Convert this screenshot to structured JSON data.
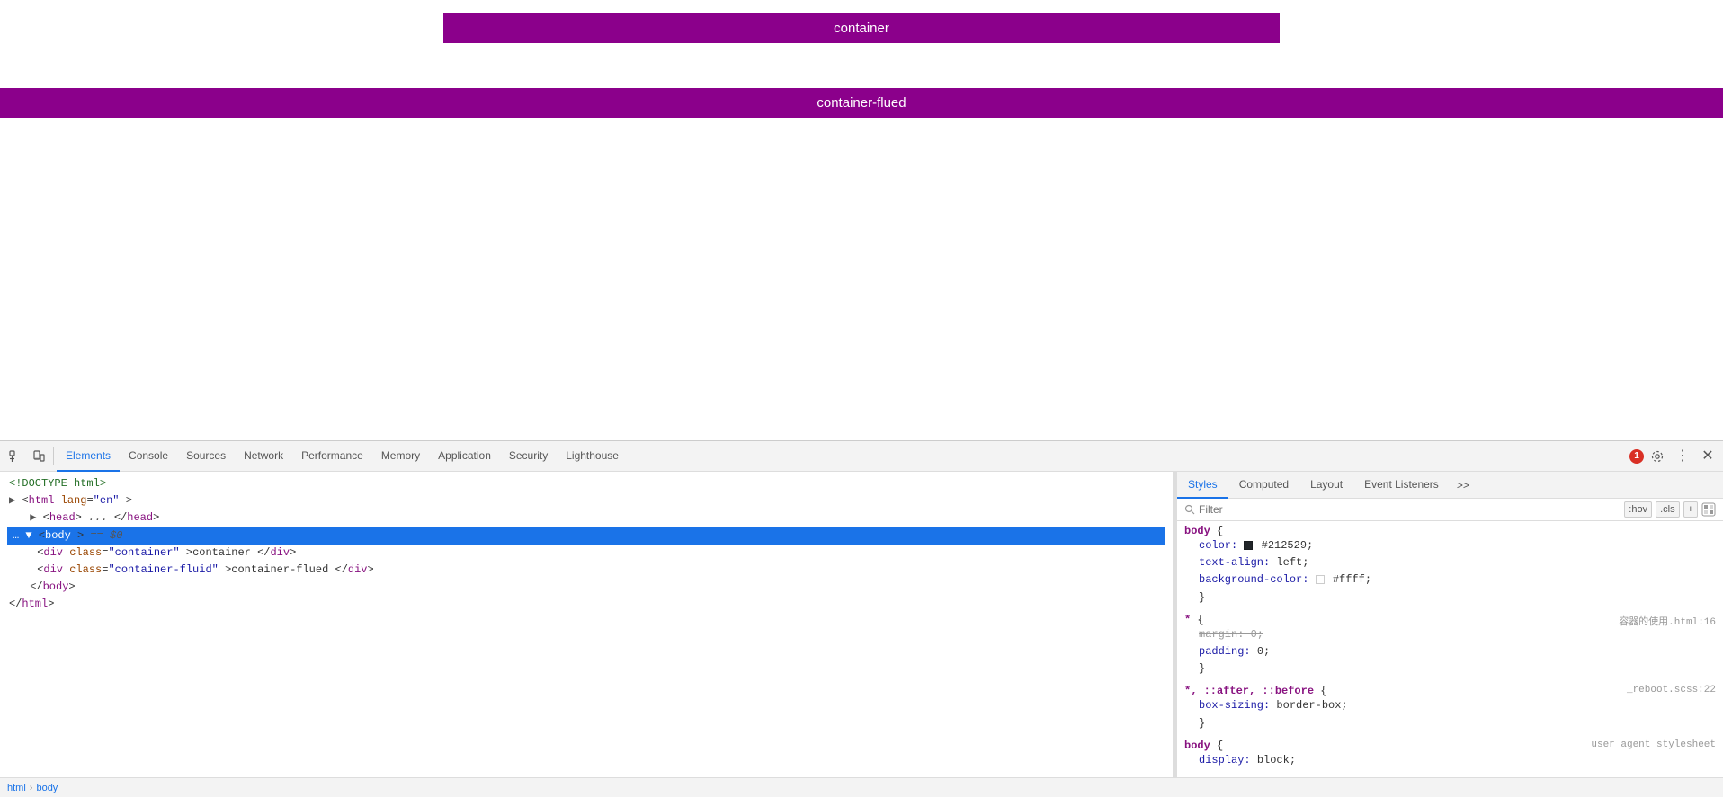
{
  "preview": {
    "container_label": "container",
    "container_fluid_label": "container-flued"
  },
  "devtools": {
    "tabs": [
      {
        "id": "elements",
        "label": "Elements",
        "active": true
      },
      {
        "id": "console",
        "label": "Console",
        "active": false
      },
      {
        "id": "sources",
        "label": "Sources",
        "active": false
      },
      {
        "id": "network",
        "label": "Network",
        "active": false
      },
      {
        "id": "performance",
        "label": "Performance",
        "active": false
      },
      {
        "id": "memory",
        "label": "Memory",
        "active": false
      },
      {
        "id": "application",
        "label": "Application",
        "active": false
      },
      {
        "id": "security",
        "label": "Security",
        "active": false
      },
      {
        "id": "lighthouse",
        "label": "Lighthouse",
        "active": false
      }
    ],
    "error_count": "1",
    "styles_tabs": [
      {
        "id": "styles",
        "label": "Styles",
        "active": true
      },
      {
        "id": "computed",
        "label": "Computed",
        "active": false
      },
      {
        "id": "layout",
        "label": "Layout",
        "active": false
      },
      {
        "id": "event-listeners",
        "label": "Event Listeners",
        "active": false
      },
      {
        "id": "more",
        "label": ">>",
        "active": false
      }
    ],
    "filter_placeholder": "Filter",
    "filter_hov": ":hov",
    "filter_cls": ".cls",
    "filter_plus": "+",
    "dom": {
      "line1": "<!DOCTYPE html>",
      "line2": "<html lang=\"en\">",
      "line3": "<head>...</head>",
      "line4": "<body> == $0",
      "line5": "  <div class=\"container\">container</div>",
      "line6": "  <div class=\"container-fluid\">container-flued</div>",
      "line7": "</body>",
      "line8": "</html>"
    },
    "breadcrumbs": [
      "html",
      "body"
    ],
    "css_rules": [
      {
        "selector": "body {",
        "source": "",
        "properties": [
          {
            "prop": "color:",
            "value": " #212529;",
            "has_swatch": true,
            "swatch_color": "#212529",
            "strikethrough": false
          },
          {
            "prop": "text-align:",
            "value": " left;",
            "has_swatch": false,
            "strikethrough": false
          },
          {
            "prop": "background-color:",
            "value": " #ffff;",
            "has_swatch": true,
            "swatch_color": "#fff",
            "strikethrough": false
          }
        ],
        "close": "}"
      },
      {
        "selector": "* {",
        "source": "容器的使用.html:16",
        "properties": [
          {
            "prop": "margin:",
            "value": " 0;",
            "has_swatch": false,
            "strikethrough": true
          },
          {
            "prop": "padding:",
            "value": " 0;",
            "has_swatch": false,
            "strikethrough": false
          }
        ],
        "close": "}"
      },
      {
        "selector": "*, ::after, ::before {",
        "source": "_reboot.scss:22",
        "properties": [
          {
            "prop": "box-sizing:",
            "value": " border-box;",
            "has_swatch": false,
            "strikethrough": false
          }
        ],
        "close": "}"
      },
      {
        "selector": "body {",
        "source": "user agent stylesheet",
        "properties": [
          {
            "prop": "display:",
            "value": " block;",
            "has_swatch": false,
            "strikethrough": false
          }
        ],
        "close": ""
      }
    ]
  }
}
